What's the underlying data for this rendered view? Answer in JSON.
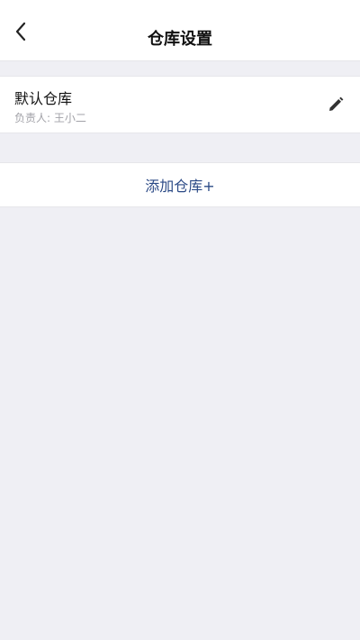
{
  "header": {
    "title": "仓库设置",
    "back_icon": "chevron-left-icon"
  },
  "warehouse": {
    "name": "默认仓库",
    "owner": "负责人: 王小二",
    "edit_icon": "pencil-icon"
  },
  "actions": {
    "add_label": "添加仓库+"
  },
  "colors": {
    "background": "#efeff4",
    "accent": "#2b4a86",
    "secondary_text": "#a2a2a8"
  }
}
